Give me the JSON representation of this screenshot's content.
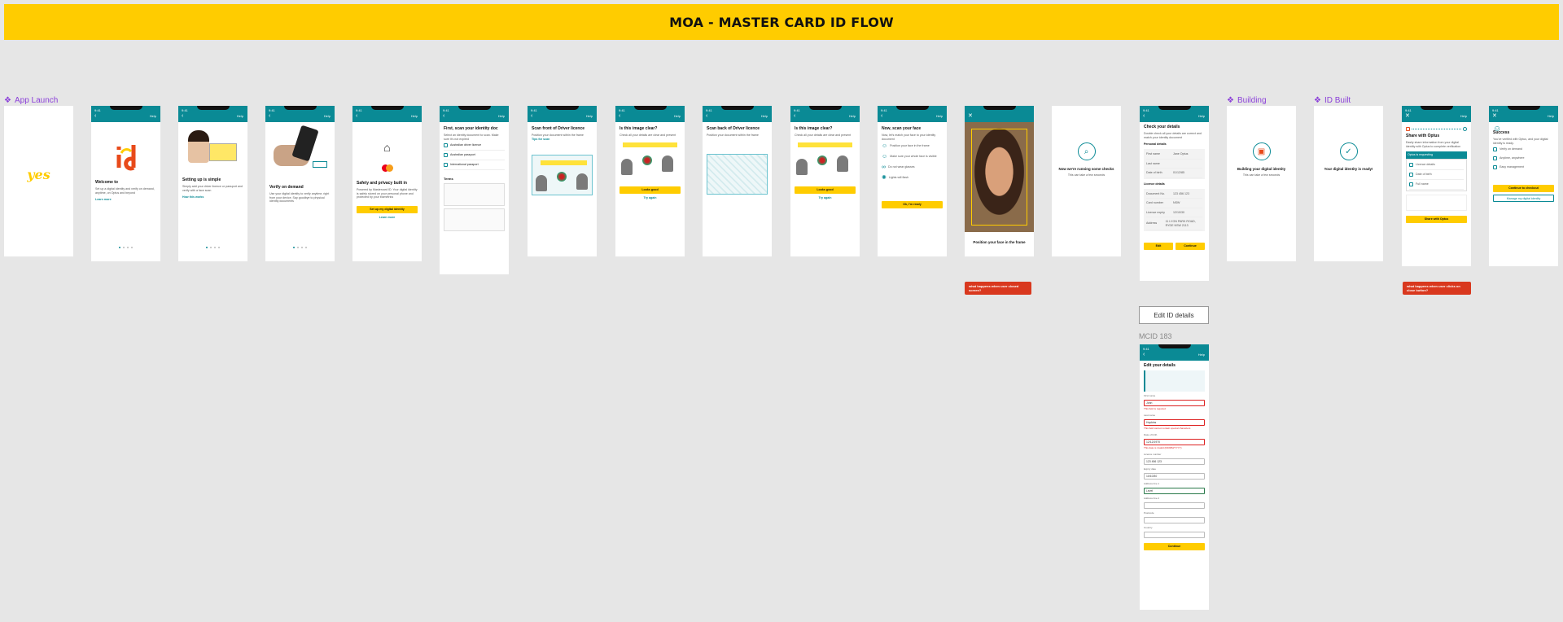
{
  "banner": {
    "title": "MOA - MASTER CARD ID FLOW"
  },
  "sections": {
    "app_launch": "App Launch",
    "building": "Building",
    "id_built": "ID Built"
  },
  "colors": {
    "brand_yellow": "#ffcc00",
    "header_teal": "#0a8a95",
    "section_purple": "#8b3fd9",
    "callout_red": "#d9381e"
  },
  "common": {
    "time": "9:41",
    "help": "Help",
    "back": "‹"
  },
  "screens": {
    "splash": {
      "logo": "yes"
    },
    "welcome": {
      "title": "Welcome to",
      "body": "Set up a digital identity and verify on demand, anytime, on Optus and beyond",
      "link": "Learn more"
    },
    "simple": {
      "title": "Setting up is simple",
      "body": "Simply add your driver licence or passport and verify with a face scan",
      "link": "How this works"
    },
    "demand": {
      "title": "Verify on demand",
      "body": "Use your digital identity to verify anytime, right from your device. Say goodbye to physical identity documents"
    },
    "privacy": {
      "title": "Safety and privacy built in",
      "body": "Powered by Mastercard ID. Your digital identity is safely stored on your personal phone and protected by your biometrics",
      "button": "Set up my digital identity",
      "link": "Learn more"
    },
    "scan_id": {
      "title": "First, scan your identity doc",
      "body": "Select an identity document to scan. Make sure it's not expired",
      "options": [
        "Australian driver licence",
        "Australian passport",
        "International passport"
      ],
      "terms": "Terms"
    },
    "scan_front": {
      "title": "Scan front of Driver licence",
      "body": "Position your document within the frame",
      "link": "Tips for scan"
    },
    "clear1": {
      "title": "Is this image clear?",
      "body": "Check all your details are clear and present",
      "button": "Looks good",
      "link": "Try again"
    },
    "scan_back": {
      "title": "Scan back of Driver licence",
      "body": "Position your document within the frame"
    },
    "clear2": {
      "title": "Is this image clear?",
      "body": "Check all your details are clear and present",
      "button": "Looks good",
      "link": "Try again"
    },
    "face_scan": {
      "title": "Now, scan your face",
      "body": "Now, let's match your face to your identity document",
      "tips": [
        "Position your face in the frame",
        "Make sure your whole face is visible",
        "Do not wear glasses",
        "Lights will flash"
      ],
      "button": "Ok, I'm ready"
    },
    "face_frame": {
      "caption": "Position your face in the frame"
    },
    "checks": {
      "title": "Now we're running some checks",
      "body": "This can take a few seconds"
    },
    "check_details": {
      "title": "Check your details",
      "body": "Double check all your details are correct and match your identity document",
      "personal": "Personal details",
      "fields": [
        [
          "First name",
          "Jane Optus"
        ],
        [
          "Last name",
          ""
        ],
        [
          "Date of birth",
          "01/12/85"
        ]
      ],
      "licence": "Licence details",
      "licence_fields": [
        [
          "Document No.",
          "123 456 123"
        ],
        [
          "Card number",
          "NSW"
        ],
        [
          "Licence expiry",
          "12/10/30"
        ],
        [
          "Address",
          "11 LYON PARK ROAD, RYDE NSW 2113"
        ]
      ],
      "button1": "Edit",
      "button2": "Continue"
    },
    "building": {
      "title": "Building your digital identity",
      "body": "This can take a few seconds"
    },
    "built": {
      "title": "Your digital identity is ready!"
    },
    "share": {
      "title": "Share with Optus",
      "body": "Easily share information from your digital identity with Optus to complete verification",
      "band": "Optus is requesting",
      "items": [
        "Licence details",
        "Date of birth",
        "Full name"
      ],
      "button": "Share with Optus"
    },
    "success": {
      "title": "Success",
      "body": "You've verified with Optus, and your digital identity is ready.",
      "items": [
        "Verify on demand",
        "Anytime, anywhere",
        "Easy management"
      ],
      "button1": "Continue to checkout",
      "button2": "Manage my digital identity"
    },
    "edit": {
      "title": "Edit your details",
      "labels": [
        "First name",
        "Last name",
        "Date of birth",
        "Licence number",
        "Expiry date",
        "Address line 1",
        "Address line 2",
        "Postcode",
        "Country"
      ],
      "values": [
        "John",
        "Hopkins",
        "12/12/1970",
        "123 456 123",
        "10/10/30",
        "Level",
        "",
        "",
        ""
      ],
      "errors": [
        "This field is required",
        "This field cannot contain special characters",
        "This date is invalid (DD/MM/YYYY)"
      ],
      "button": "Continue"
    }
  },
  "callouts": {
    "one": "what happens when user closed screen?",
    "two": "what happens when user clicks on close button?"
  },
  "edit_button": "Edit ID details",
  "mcid": "MCID 183"
}
